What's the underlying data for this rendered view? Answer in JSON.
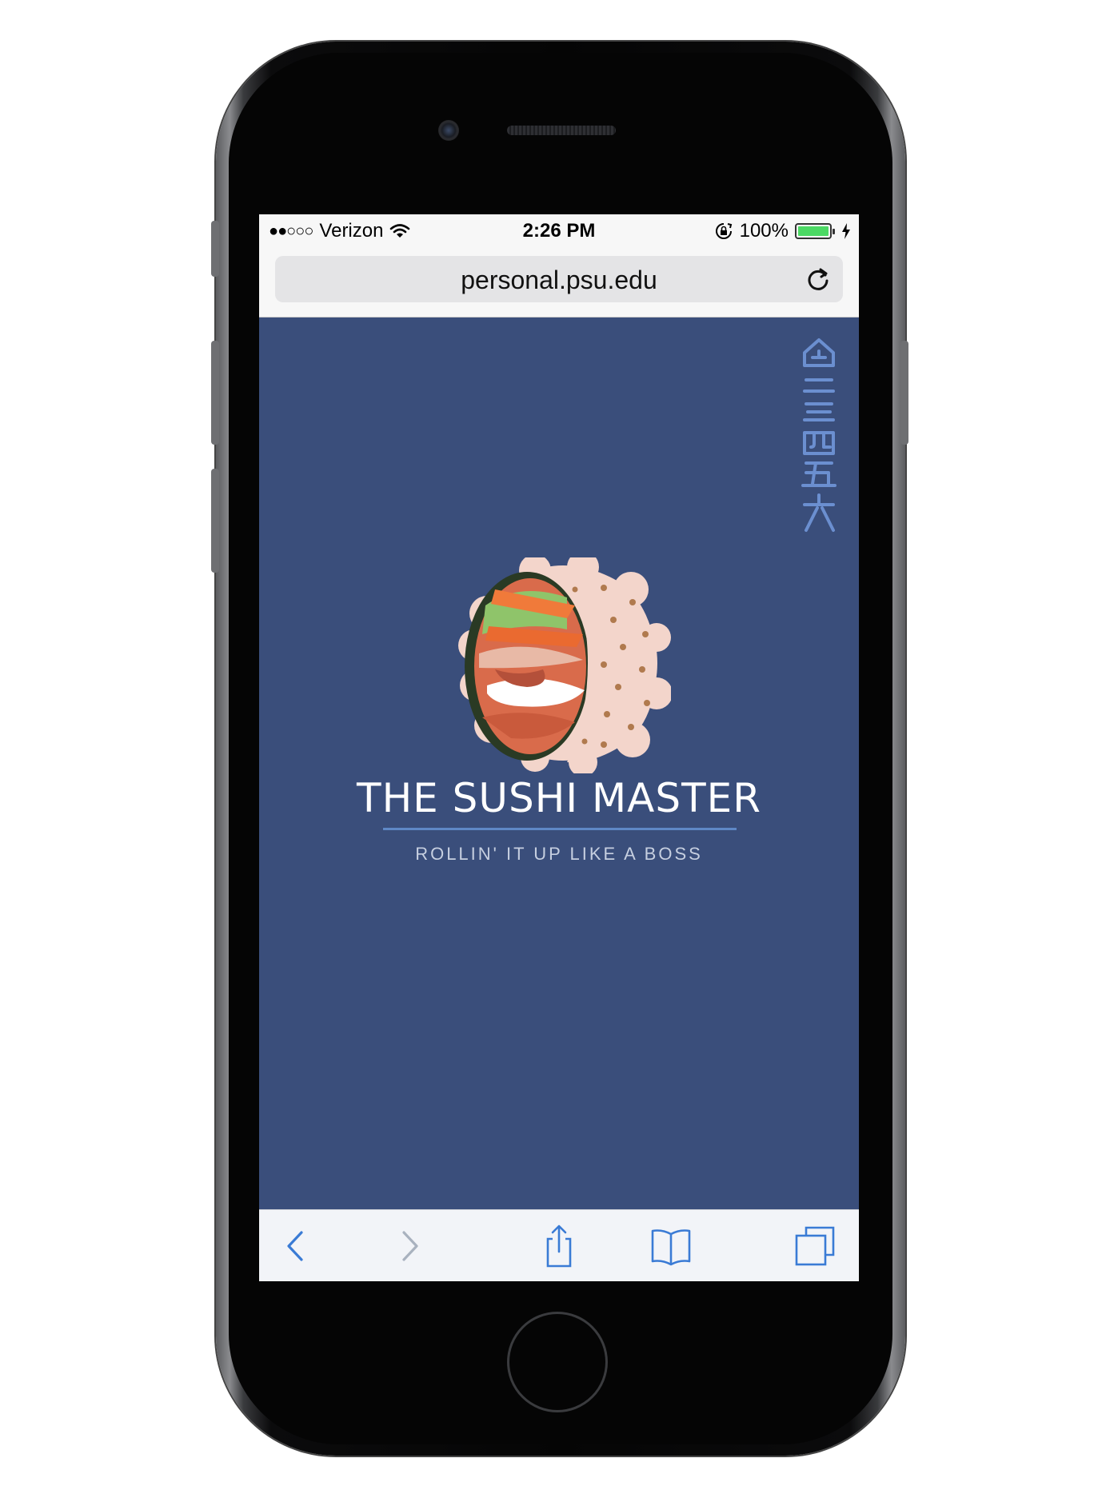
{
  "status_bar": {
    "signal": "●●○○○",
    "carrier": "Verizon",
    "time": "2:26 PM",
    "battery_percent": "100%",
    "battery_level": 1.0,
    "icons": [
      "wifi-icon",
      "rotation-lock-icon",
      "battery-icon",
      "charging-bolt-icon"
    ]
  },
  "browser": {
    "url": "personal.psu.edu",
    "toolbar": [
      "back-icon",
      "forward-icon",
      "share-icon",
      "bookmarks-icon",
      "tabs-icon"
    ],
    "accent_color": "#3a7bd5"
  },
  "page": {
    "background_color": "#3a4e7b",
    "title": "THE SUSHI MASTER",
    "tagline": "ROLLIN' IT UP LIKE A BOSS",
    "nav_glyphs": [
      "home-icon",
      "二",
      "三",
      "四",
      "五",
      "六"
    ],
    "rule_color": "#5f88c6"
  }
}
